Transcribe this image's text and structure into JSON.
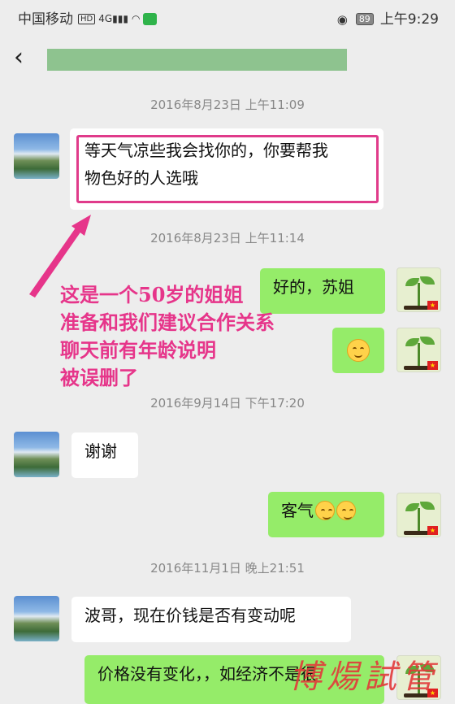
{
  "status_bar": {
    "carrier": "中国移动",
    "network_badge": "HD",
    "signal_label": "4G",
    "battery": "89",
    "time": "上午9:29",
    "icons": [
      "hd-icon",
      "signal-icon",
      "wifi-icon",
      "wechat-icon",
      "eye-icon",
      "battery-icon"
    ]
  },
  "nav": {
    "back_icon": "chevron-left-icon",
    "title_redacted_color": "#8ec38f"
  },
  "timestamps": {
    "t1": "2016年8月23日 上午11:09",
    "t2": "2016年8月23日 上午11:14",
    "t3": "2016年9月14日 下午17:20",
    "t4": "2016年11月1日 晚上21:51"
  },
  "messages": {
    "m1": "等天气凉些我会找你的，你要帮我物色好的人选哦",
    "m1_line1": "等天气凉些我会找你的，你要帮我",
    "m1_line2": "物色好的人选哦",
    "m2": "好的，苏姐",
    "m4": "谢谢",
    "m5": "客气",
    "m6": "波哥，现在价钱是否有变动呢",
    "m7": "价格没有变化，，如经济不是很"
  },
  "annotation": {
    "lines": [
      "这是一个50岁的姐姐",
      "准备和我们建议合作关系",
      "聊天前有年龄说明",
      "被误删了"
    ],
    "color": "#e6358a"
  },
  "watermark": "博煬試管",
  "colors": {
    "background": "#ededed",
    "bubble_self": "#95ec69",
    "bubble_other": "#ffffff"
  }
}
